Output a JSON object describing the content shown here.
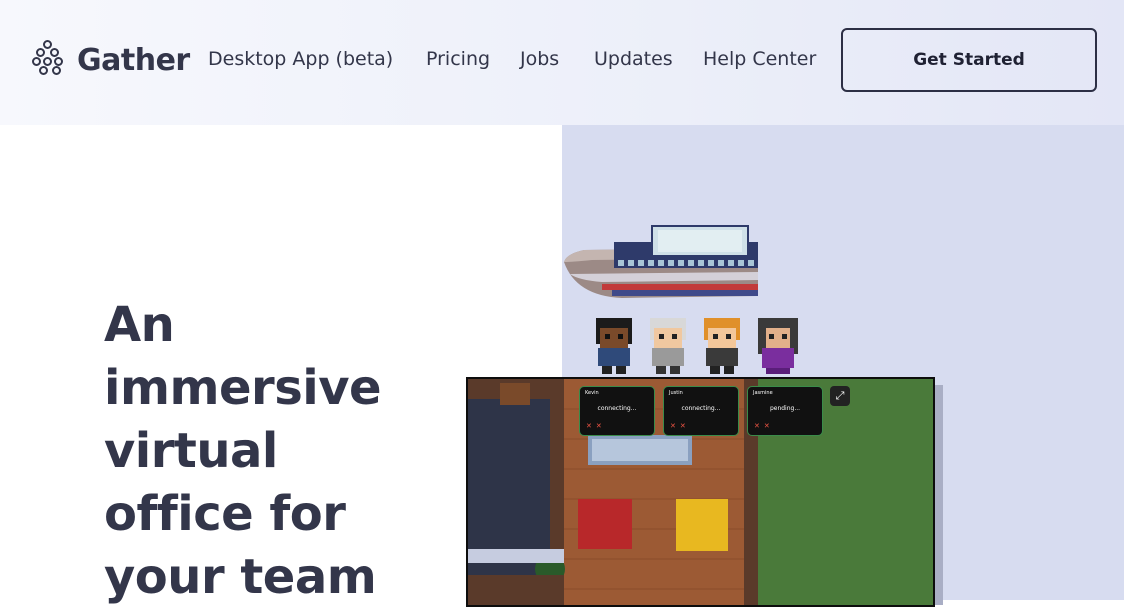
{
  "brand": {
    "name": "Gather",
    "logo_icon": "gather-grape-logo-icon"
  },
  "nav": {
    "items": [
      {
        "label": "Desktop App (beta)"
      },
      {
        "label": "Pricing"
      },
      {
        "label": "Jobs"
      },
      {
        "label": "Updates"
      },
      {
        "label": "Help Center"
      }
    ],
    "cta_label": "Get Started"
  },
  "hero": {
    "headline_lines": [
      "An",
      "immersive",
      "virtual",
      "office for",
      "your team"
    ]
  },
  "game_preview": {
    "video_cards": [
      {
        "name": "Kevin",
        "status": "connecting..."
      },
      {
        "name": "Justin",
        "status": "connecting..."
      },
      {
        "name": "Jasmine",
        "status": "pending..."
      }
    ],
    "expand_icon": "expand-icon"
  },
  "colors": {
    "header_bg": "#eceff9",
    "hero_panel_bg": "#d7dcf0",
    "text": "#33364a",
    "grass": "#4a7a3a",
    "wood_floor": "#9c5a34"
  }
}
